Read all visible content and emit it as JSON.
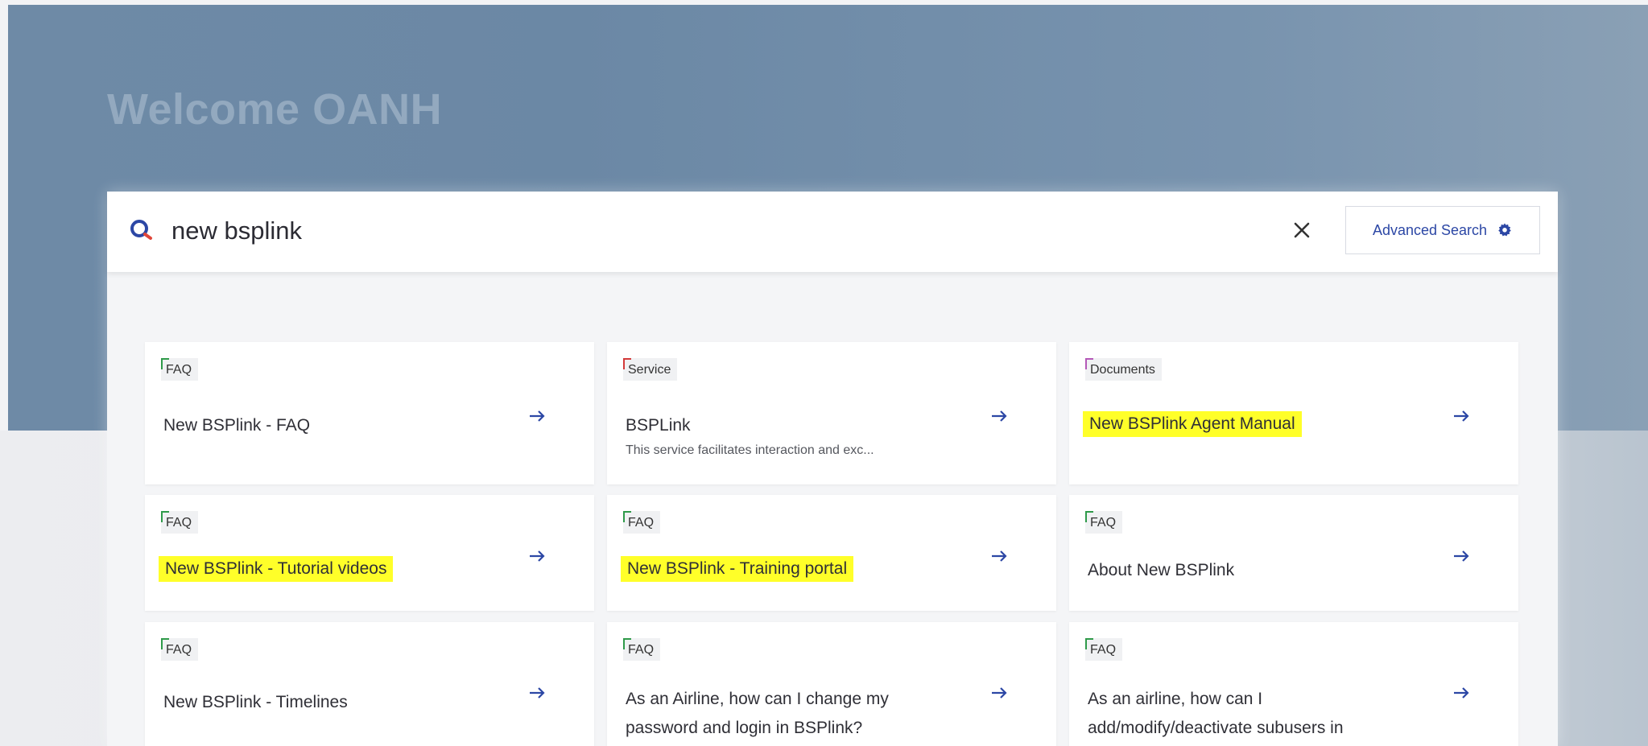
{
  "hero": {
    "welcome_text": "Welcome OANH"
  },
  "search": {
    "query": "new bsplink",
    "advanced_label": "Advanced Search"
  },
  "colors": {
    "accent": "#2c47a5",
    "highlight": "#ffff29",
    "tag_faq": "#2f9a4a",
    "tag_service": "#d33a3a",
    "tag_documents": "#b458b8"
  },
  "results": [
    {
      "tag": "FAQ",
      "title": "New BSPlink - FAQ",
      "description": "",
      "highlighted": false
    },
    {
      "tag": "Service",
      "title": "BSPLink",
      "description": "This service  facilitates interaction and exc...",
      "highlighted": false
    },
    {
      "tag": "Documents",
      "title": "New BSPlink Agent Manual",
      "description": "",
      "highlighted": true
    },
    {
      "tag": "FAQ",
      "title": "New BSPlink - Tutorial videos",
      "description": "",
      "highlighted": true
    },
    {
      "tag": "FAQ",
      "title": "New BSPlink - Training portal",
      "description": "",
      "highlighted": true
    },
    {
      "tag": "FAQ",
      "title": "About New BSPlink",
      "description": "",
      "highlighted": false
    },
    {
      "tag": "FAQ",
      "title": "New BSPlink - Timelines",
      "description": "",
      "highlighted": false
    },
    {
      "tag": "FAQ",
      "title": "As an Airline, how can I change my password and login in BSPlink?",
      "description": "",
      "highlighted": false
    },
    {
      "tag": "FAQ",
      "title": "As an airline, how can I add/modify/deactivate subusers in",
      "description": "",
      "highlighted": false
    }
  ],
  "icons": {
    "search": "search-icon",
    "clear": "close-icon",
    "advanced": "gear-icon",
    "open": "arrow-right-icon"
  }
}
